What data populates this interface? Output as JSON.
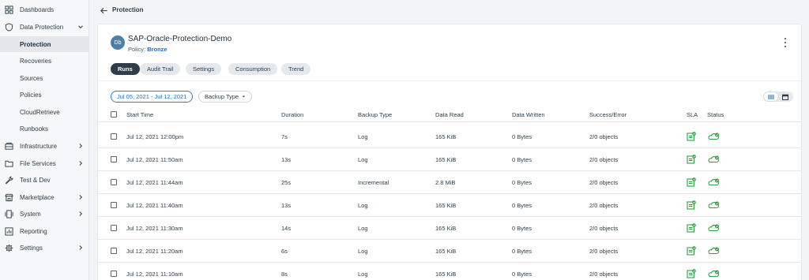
{
  "sidebar": {
    "items": [
      {
        "label": "Dashboards",
        "icon": "dashboards-icon",
        "has_chevron": false
      },
      {
        "label": "Data Protection",
        "icon": "shield-icon",
        "has_chevron": true,
        "expanded": true
      },
      {
        "label": "Protection",
        "sub": true,
        "active": true
      },
      {
        "label": "Recoveries",
        "sub": true
      },
      {
        "label": "Sources",
        "sub": true
      },
      {
        "label": "Policies",
        "sub": true
      },
      {
        "label": "CloudRetrieve",
        "sub": true
      },
      {
        "label": "Runbooks",
        "sub": true
      },
      {
        "label": "Infrastructure",
        "icon": "infrastructure-icon",
        "has_chevron": true
      },
      {
        "label": "File Services",
        "icon": "folder-icon",
        "has_chevron": true
      },
      {
        "label": "Test & Dev",
        "icon": "wrench-icon",
        "has_chevron": false
      },
      {
        "label": "Marketplace",
        "icon": "marketplace-icon",
        "has_chevron": true
      },
      {
        "label": "System",
        "icon": "system-icon",
        "has_chevron": true
      },
      {
        "label": "Reporting",
        "icon": "reporting-icon",
        "has_chevron": false
      },
      {
        "label": "Settings",
        "icon": "gear-icon",
        "has_chevron": true
      }
    ]
  },
  "breadcrumb": {
    "label": "Protection"
  },
  "object": {
    "avatar": "Db",
    "title": "SAP-Oracle-Protection-Demo",
    "policy_label": "Policy: ",
    "policy_value": "Bronze"
  },
  "tabs": [
    "Runs",
    "Audit Trail",
    "Settings",
    "Consumption",
    "Trend"
  ],
  "filters": {
    "date_range": "Jul 05, 2021 - Jul 12, 2021",
    "backup_type": "Backup Type"
  },
  "table": {
    "columns": [
      "Start Time",
      "Duration",
      "Backup Type",
      "Data Read",
      "Data Written",
      "Success/Error",
      "SLA",
      "Status"
    ],
    "rows": [
      [
        "Jul 12, 2021 12:00pm",
        "7s",
        "Log",
        "165 KiB",
        "0 Bytes",
        "2/0 objects"
      ],
      [
        "Jul 12, 2021 11:50am",
        "13s",
        "Log",
        "165 KiB",
        "0 Bytes",
        "2/0 objects"
      ],
      [
        "Jul 12, 2021 11:44am",
        "25s",
        "Incremental",
        "2.8 MiB",
        "0 Bytes",
        "2/0 objects"
      ],
      [
        "Jul 12, 2021 11:40am",
        "13s",
        "Log",
        "165 KiB",
        "0 Bytes",
        "2/0 objects"
      ],
      [
        "Jul 12, 2021 11:30am",
        "14s",
        "Log",
        "165 KiB",
        "0 Bytes",
        "2/0 objects"
      ],
      [
        "Jul 12, 2021 11:20am",
        "6s",
        "Log",
        "165 KiB",
        "0 Bytes",
        "2/0 objects"
      ],
      [
        "Jul 12, 2021 11:10am",
        "8s",
        "Log",
        "165 KiB",
        "0 Bytes",
        "2/0 objects"
      ]
    ]
  },
  "colors": {
    "accent": "#1d6fb8",
    "success": "#2e9e3f",
    "dark": "#2f3d48"
  }
}
